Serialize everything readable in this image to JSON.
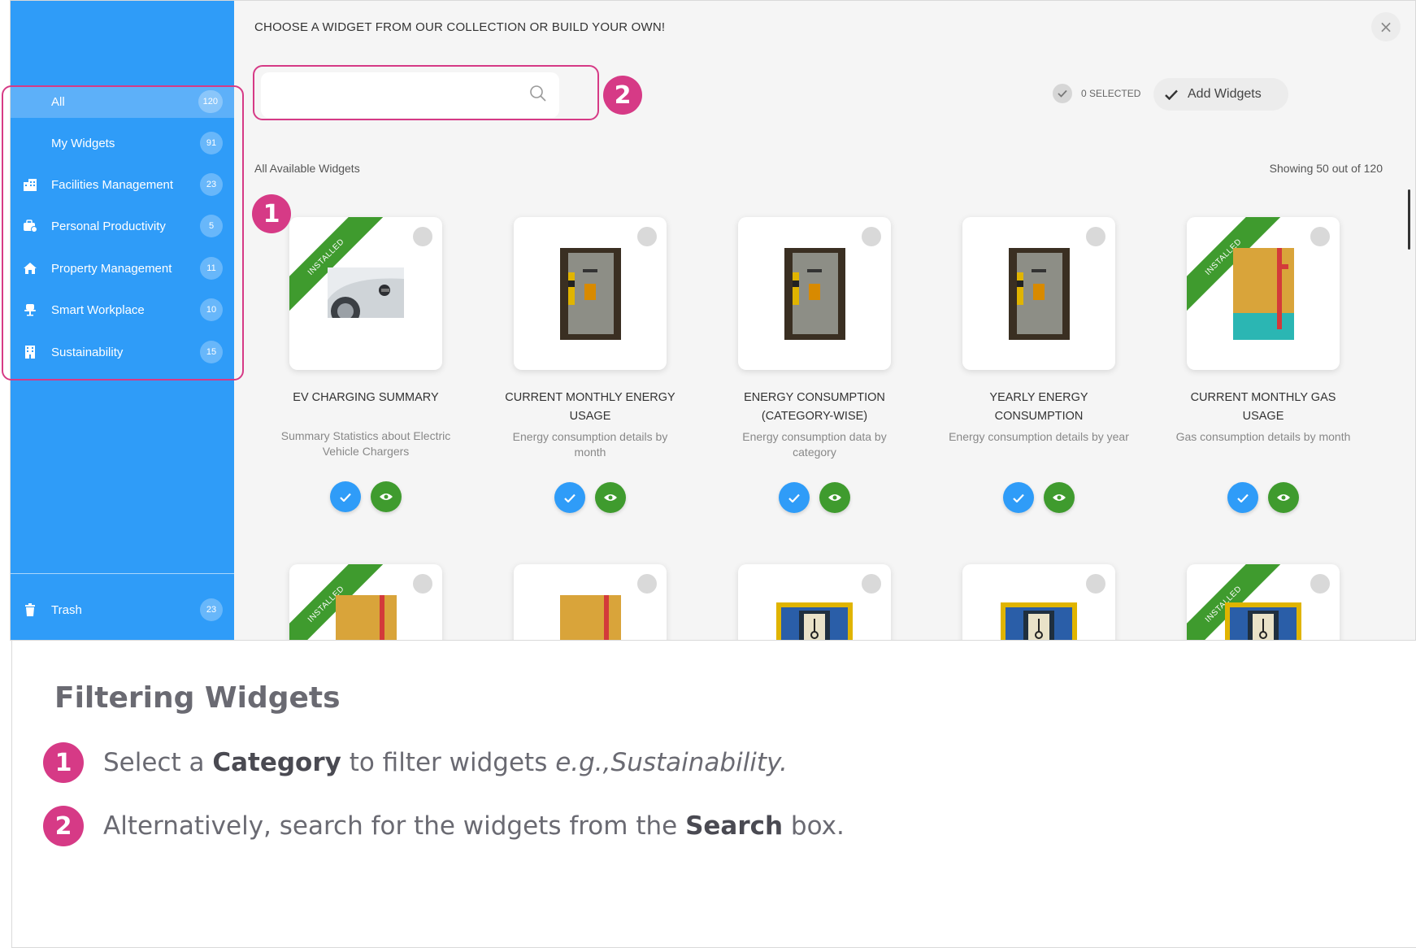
{
  "modal": {
    "title": "CHOOSE A WIDGET FROM OUR COLLECTION OR BUILD YOUR OWN!",
    "close_icon": "×",
    "search_placeholder": "",
    "selected_label": "0 SELECTED",
    "add_button": "Add Widgets",
    "available_label": "All Available Widgets",
    "showing_label": "Showing 50 out of 120"
  },
  "sidebar": {
    "items": [
      {
        "label": "All",
        "count": "120",
        "icon": "none"
      },
      {
        "label": "My Widgets",
        "count": "91",
        "icon": "none"
      },
      {
        "label": "Facilities Management",
        "count": "23",
        "icon": "building-icon"
      },
      {
        "label": "Personal Productivity",
        "count": "5",
        "icon": "briefcase-icon"
      },
      {
        "label": "Property Management",
        "count": "11",
        "icon": "home-icon"
      },
      {
        "label": "Smart Workplace",
        "count": "10",
        "icon": "chair-icon"
      },
      {
        "label": "Sustainability",
        "count": "15",
        "icon": "office-icon"
      }
    ],
    "trash": {
      "label": "Trash",
      "count": "23",
      "icon": "trash-icon"
    }
  },
  "widgets": [
    {
      "title": "EV CHARGING SUMMARY",
      "desc": "Summary Statistics about Electric Vehicle Chargers",
      "installed": true,
      "ribbon": "INSTALLED"
    },
    {
      "title": "CURRENT MONTHLY ENERGY USAGE",
      "desc": "Energy consumption details by month",
      "installed": false
    },
    {
      "title": "ENERGY CONSUMPTION (CATEGORY-WISE)",
      "desc": "Energy consumption data by category",
      "installed": false
    },
    {
      "title": "YEARLY ENERGY CONSUMPTION",
      "desc": "Energy consumption details by year",
      "installed": false
    },
    {
      "title": "CURRENT MONTHLY GAS USAGE",
      "desc": "Gas consumption details by month",
      "installed": true,
      "ribbon": "INSTALLED"
    }
  ],
  "second_row": [
    {
      "installed": true,
      "ribbon": "INSTALLED"
    },
    {
      "installed": false
    },
    {
      "installed": false
    },
    {
      "installed": false
    },
    {
      "installed": true,
      "ribbon": "INSTALLED"
    }
  ],
  "callouts": {
    "one": "1",
    "two": "2"
  },
  "caption": {
    "title": "Filtering Widgets",
    "step1": {
      "num": "1",
      "pre": "Select a ",
      "bold": "Category",
      "mid": " to filter widgets ",
      "italic": "e.g.,Sustainability."
    },
    "step2": {
      "num": "2",
      "pre": "Alternatively, search for the widgets from the ",
      "bold": "Search",
      "post": " box."
    }
  },
  "colors": {
    "sidebar": "#2f9cf8",
    "highlight": "#d63a86",
    "installed": "#3f9b2e",
    "accent": "#2f9cf8"
  }
}
